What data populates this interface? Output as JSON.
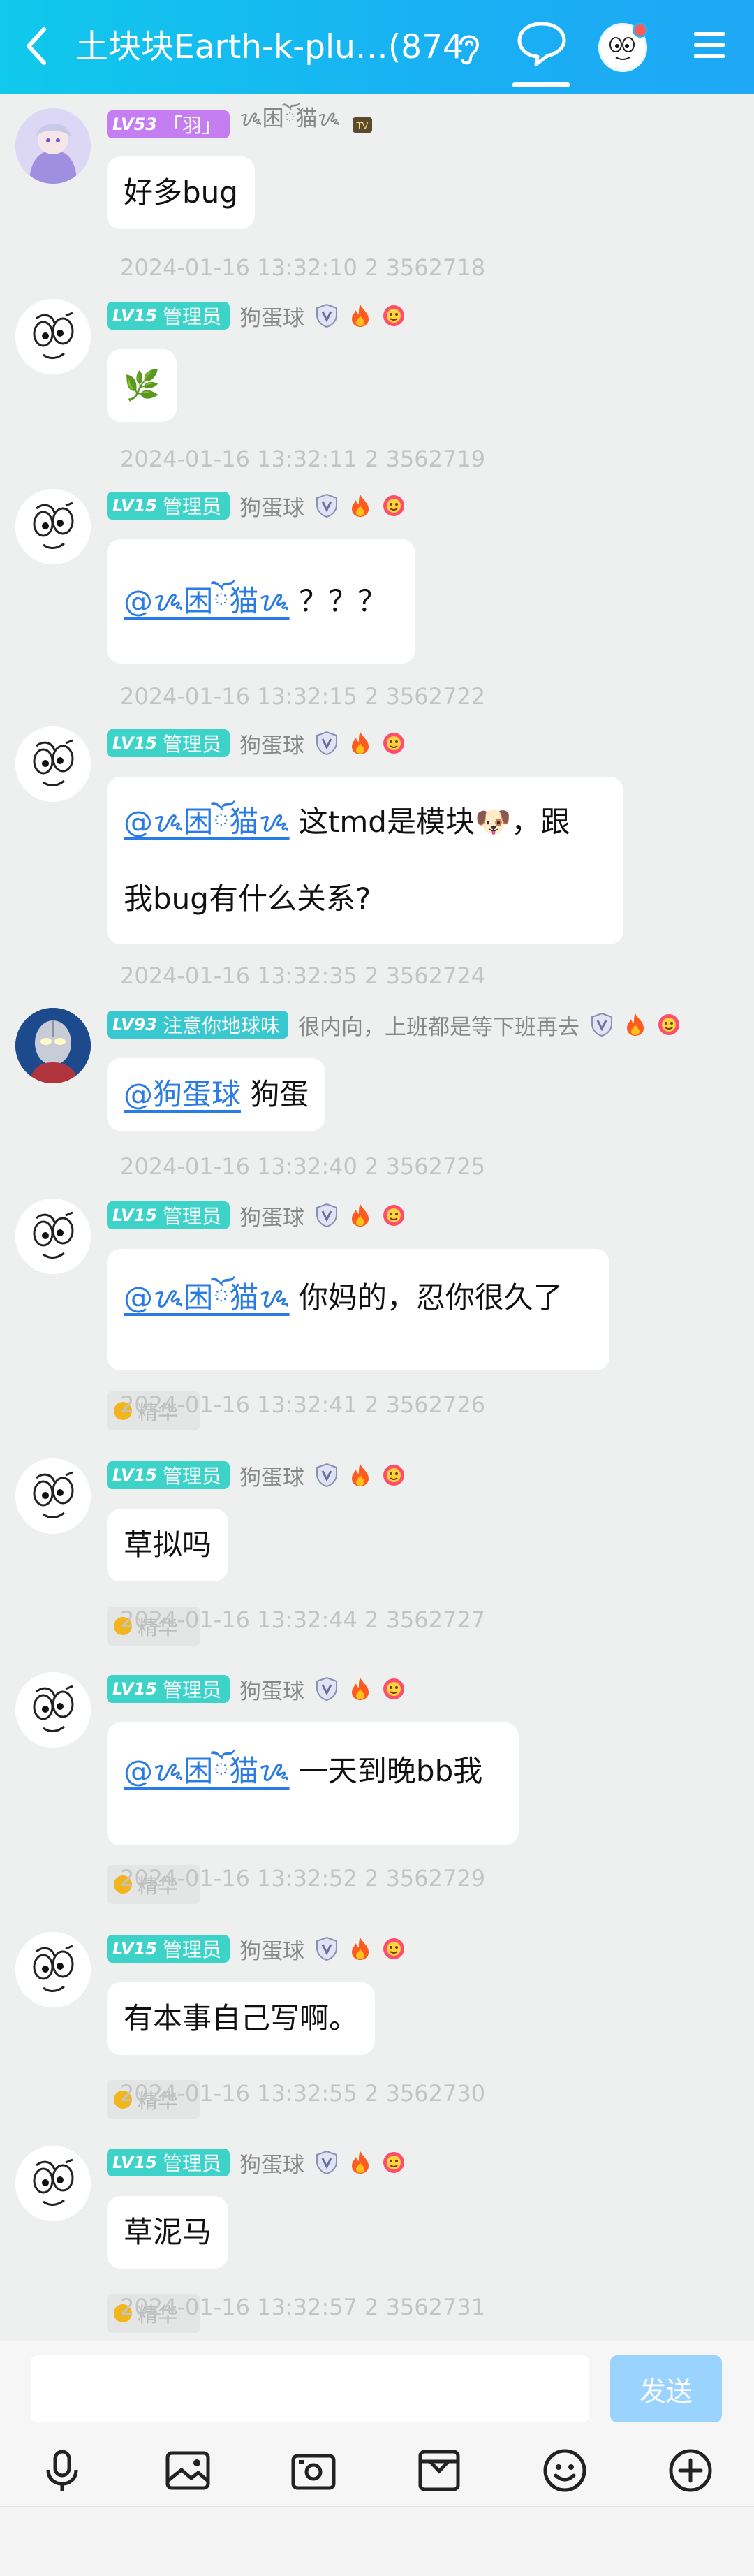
{
  "header": {
    "title": "土块块Earth-k-plu…(874)",
    "back_icon": "back-arrow-icon",
    "accent": "#19b0f3"
  },
  "messages": [
    {
      "avatar": "anime-avatar",
      "level": "LV53",
      "title": "「羽」",
      "nickname": "ᝰ困ོ猫ᝰ",
      "level_color": "#c57ef2",
      "text": "好多bug",
      "timestamp": "2024-01-16 13:32:10 2 3562718"
    },
    {
      "avatar": "meme-face-avatar",
      "level": "LV15",
      "title": "管理员",
      "nickname": "狗蛋球",
      "text": "🌿",
      "timestamp": "2024-01-16 13:32:11 2 3562719"
    },
    {
      "avatar": "meme-face-avatar",
      "level": "LV15",
      "title": "管理员",
      "nickname": "狗蛋球",
      "mention": "@ᝰ困ོ猫ᝰ",
      "text": "？？？",
      "timestamp": "2024-01-16 13:32:15 2 3562722"
    },
    {
      "avatar": "meme-face-avatar",
      "level": "LV15",
      "title": "管理员",
      "nickname": "狗蛋球",
      "mention": "@ᝰ困ོ猫ᝰ",
      "text_line1": "这tmd是模块🐶，跟",
      "text_line2": "我bug有什么关系?",
      "timestamp": "2024-01-16 13:32:35 2 3562724"
    },
    {
      "avatar": "ultraman-avatar",
      "level": "LV93",
      "title": "注意你地球味",
      "nickname": "很内向，上班都是等下班再去",
      "mention": "@狗蛋球",
      "text": "狗蛋",
      "timestamp": "2024-01-16 13:32:40 2 3562725"
    },
    {
      "avatar": "meme-face-avatar",
      "level": "LV15",
      "title": "管理员",
      "nickname": "狗蛋球",
      "mention": "@ᝰ困ོ猫ᝰ",
      "text": "你妈的，忍你很久了",
      "timestamp": "2024-01-16 13:32:41 2 3562726",
      "essence": "精华"
    },
    {
      "avatar": "meme-face-avatar",
      "level": "LV15",
      "title": "管理员",
      "nickname": "狗蛋球",
      "text": "草拟吗",
      "timestamp": "2024-01-16 13:32:44 2 3562727",
      "essence": "精华"
    },
    {
      "avatar": "meme-face-avatar",
      "level": "LV15",
      "title": "管理员",
      "nickname": "狗蛋球",
      "mention": "@ᝰ困ོ猫ᝰ",
      "text": "一天到晚bb我",
      "timestamp": "2024-01-16 13:32:52 2 3562729",
      "essence": "精华"
    },
    {
      "avatar": "meme-face-avatar",
      "level": "LV15",
      "title": "管理员",
      "nickname": "狗蛋球",
      "text": "有本事自己写啊。",
      "timestamp": "2024-01-16 13:32:55 2 3562730",
      "essence": "精华"
    },
    {
      "avatar": "meme-face-avatar",
      "level": "LV15",
      "title": "管理员",
      "nickname": "狗蛋球",
      "text": "草泥马",
      "timestamp": "2024-01-16 13:32:57 2 3562731",
      "essence": "精华"
    }
  ],
  "composer": {
    "input_value": "",
    "placeholder": "",
    "send_label": "发送"
  },
  "toolbar_icons": [
    "microphone-icon",
    "image-icon",
    "camera-icon",
    "archive-icon",
    "emoji-icon",
    "plus-icon"
  ]
}
